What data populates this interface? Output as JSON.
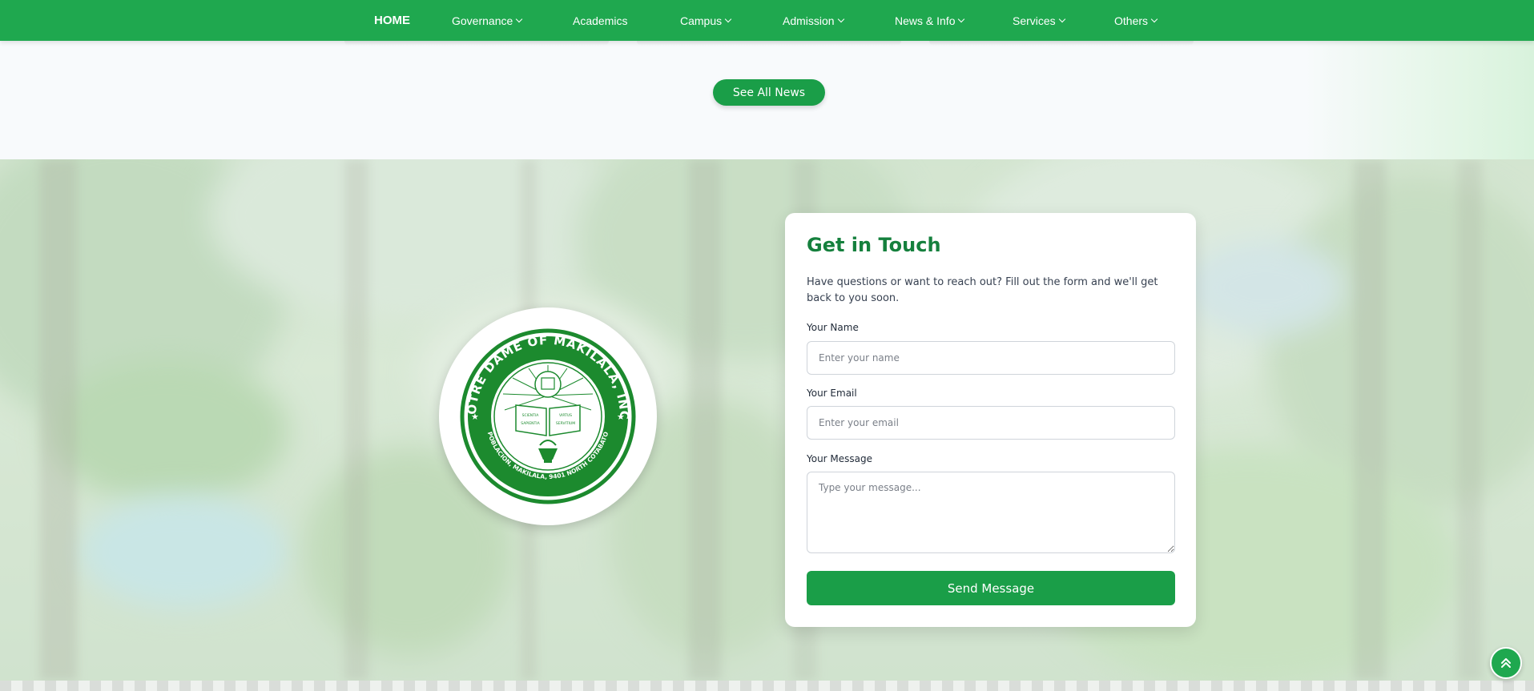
{
  "nav": {
    "items": [
      {
        "label": "HOME",
        "active": true,
        "dropdown": false
      },
      {
        "label": "Governance",
        "dropdown": true
      },
      {
        "label": "Academics",
        "dropdown": false
      },
      {
        "label": "Campus",
        "dropdown": true
      },
      {
        "label": "Admission",
        "dropdown": true
      },
      {
        "label": "News & Info",
        "dropdown": true
      },
      {
        "label": "Services",
        "dropdown": true
      },
      {
        "label": "Others",
        "dropdown": true
      }
    ]
  },
  "news": {
    "see_all_label": "See All News"
  },
  "seal": {
    "top_text": "NOTRE DAME OF MAKILALA, INC.",
    "bottom_text": "POBLACION, MAKILALA, 9401 NORTH COTABATO",
    "book_text": [
      "SCIENTIA",
      "VIRTUS",
      "SAPIENTIA",
      "SERVITIUM"
    ]
  },
  "contact": {
    "title": "Get in Touch",
    "description": "Have questions or want to reach out? Fill out the form and we'll get back to you soon.",
    "name_label": "Your Name",
    "name_placeholder": "Enter your name",
    "email_label": "Your Email",
    "email_placeholder": "Enter your email",
    "message_label": "Your Message",
    "message_placeholder": "Type your message...",
    "submit_label": "Send Message"
  },
  "colors": {
    "primary": "#1fa84f",
    "button": "#1a9e48",
    "heading": "#15803d",
    "seal_green": "#1c8a2e"
  },
  "icons": {
    "scroll_top": "double-chevron-up-icon",
    "dropdown": "chevron-down-icon"
  }
}
